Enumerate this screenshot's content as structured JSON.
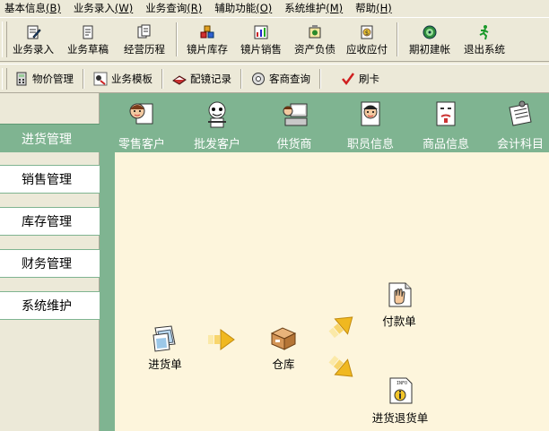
{
  "menu": [
    {
      "label": "基本信息",
      "key": "(B)"
    },
    {
      "label": "业务录入",
      "key": "(W)"
    },
    {
      "label": "业务查询",
      "key": "(R)"
    },
    {
      "label": "辅助功能",
      "key": "(O)"
    },
    {
      "label": "系统维护",
      "key": "(M)"
    },
    {
      "label": "帮助",
      "key": "(H)"
    }
  ],
  "toolbar1": [
    {
      "label": "业务录入",
      "icon": "document-edit-icon"
    },
    {
      "label": "业务草稿",
      "icon": "draft-icon"
    },
    {
      "label": "经营历程",
      "icon": "history-icon"
    },
    {
      "label": "镜片库存",
      "icon": "lens-stock-icon"
    },
    {
      "label": "镜片销售",
      "icon": "lens-sales-icon"
    },
    {
      "label": "资产负债",
      "icon": "balance-sheet-icon"
    },
    {
      "label": "应收应付",
      "icon": "receivable-icon"
    },
    {
      "label": "期初建帐",
      "icon": "opening-account-icon"
    },
    {
      "label": "退出系统",
      "icon": "exit-runner-icon"
    }
  ],
  "toolbar2": [
    {
      "label": "物价管理",
      "icon": "calculator-icon"
    },
    {
      "label": "业务模板",
      "icon": "template-icon"
    },
    {
      "label": "配镜记录",
      "icon": "glasses-record-icon"
    },
    {
      "label": "客商查询",
      "icon": "search-disc-icon"
    },
    {
      "label": "刷卡",
      "icon": "checkmark-icon"
    }
  ],
  "nav": {
    "active": "进货管理",
    "items": [
      "销售管理",
      "库存管理",
      "财务管理",
      "系统维护"
    ]
  },
  "header_items": [
    {
      "label": "零售客户",
      "icon": "retail-customer-icon"
    },
    {
      "label": "批发客户",
      "icon": "wholesale-customer-icon"
    },
    {
      "label": "供货商",
      "icon": "supplier-icon"
    },
    {
      "label": "职员信息",
      "icon": "staff-icon"
    },
    {
      "label": "商品信息",
      "icon": "product-icon"
    },
    {
      "label": "会计科目",
      "icon": "accounting-icon"
    }
  ],
  "workflow": {
    "purchase_order": "进货单",
    "warehouse": "仓库",
    "payment_order": "付款单",
    "return_order": "进货退货单"
  },
  "colors": {
    "panel_green": "#7fb491",
    "workspace_bg": "#fdf5dc",
    "window_bg": "#ece9d8"
  }
}
